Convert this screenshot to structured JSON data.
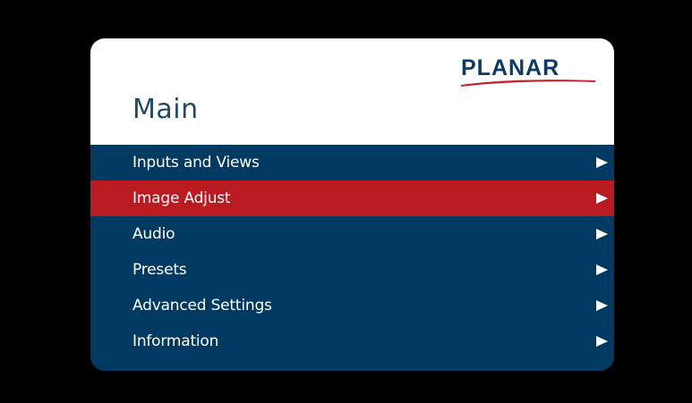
{
  "menu": {
    "title": "Main",
    "brand": "PLANAR",
    "items": [
      {
        "label": "Inputs and Views",
        "icon": "arrow-right-icon",
        "selected": false
      },
      {
        "label": "Image Adjust",
        "icon": "arrow-right-icon",
        "selected": true
      },
      {
        "label": "Audio",
        "icon": "arrow-right-icon",
        "selected": false
      },
      {
        "label": "Presets",
        "icon": "arrow-right-icon",
        "selected": false
      },
      {
        "label": "Advanced Settings",
        "icon": "arrow-right-icon",
        "selected": false
      },
      {
        "label": "Information",
        "icon": "arrow-right-icon",
        "selected": false
      }
    ]
  },
  "colors": {
    "background": "#000000",
    "panel_blue": "#003a63",
    "selected_red": "#b91b21",
    "header_white": "#ffffff",
    "title_text": "#1f4a6b",
    "brand_blue": "#0d3a63",
    "brand_swoosh": "#c0272d"
  }
}
